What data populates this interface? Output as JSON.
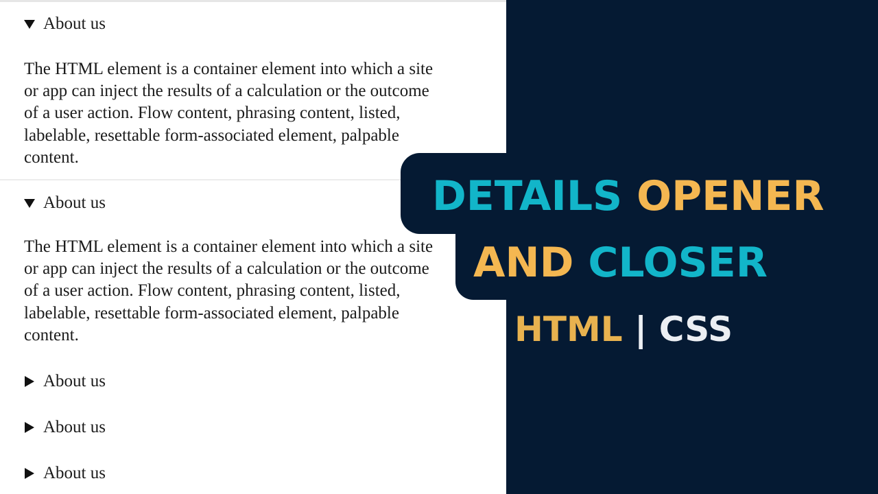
{
  "details": {
    "items": [
      {
        "summary": "About us",
        "open": true,
        "lines": [
          "The HTML element is a container element into which a site",
          "or app can inject the results of a calculation or the outcome",
          "of a user action. Flow content, phrasing content, listed,",
          "labelable, resettable form-associated element, palpable",
          "content."
        ]
      },
      {
        "summary": "About us",
        "open": true,
        "lines": [
          "The HTML element is a container element into which a site",
          "or app can inject the results of a calculation or the outcome",
          "of a user action. Flow content, phrasing content, listed,",
          "labelable, resettable form-associated element, palpable",
          "content."
        ]
      },
      {
        "summary": "About us",
        "open": false
      },
      {
        "summary": "About us",
        "open": false
      },
      {
        "summary": "About us",
        "open": false
      }
    ]
  },
  "banner": {
    "line1_word1": "DETAILS",
    "line1_word2": "OPENER",
    "line2_word1": "AND",
    "line2_word2": "CLOSER",
    "tech_html": "HTML",
    "tech_sep": "|",
    "tech_css": "CSS"
  },
  "colors": {
    "dark_panel": "#051a33",
    "cyan_accent": "#12b5c9",
    "gold_accent": "#f4b751",
    "light_text": "#eceff3"
  },
  "icons": {
    "open_marker": "triangle-down-icon",
    "closed_marker": "triangle-right-icon"
  }
}
